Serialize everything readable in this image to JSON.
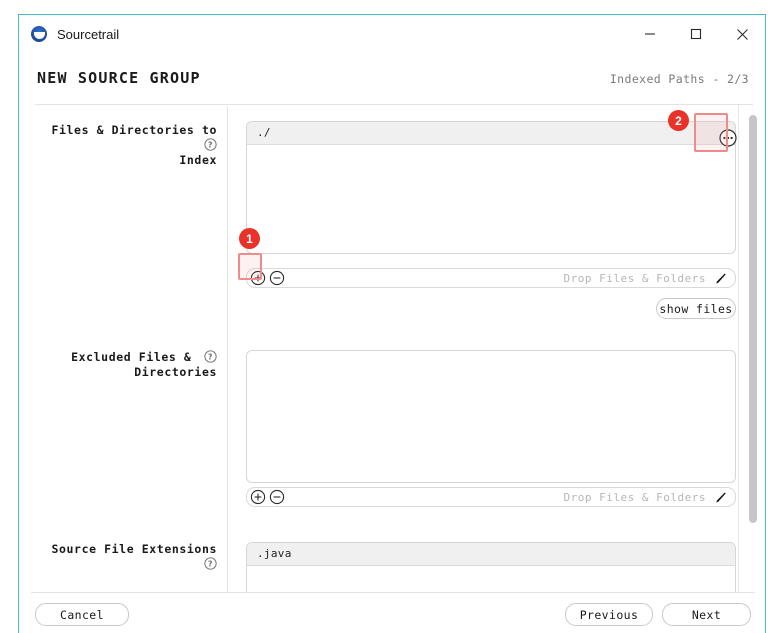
{
  "window": {
    "title": "Sourcetrail",
    "app_icon": "sourcetrail-logo-icon",
    "controls": {
      "minimize": "minimize-icon",
      "maximize": "maximize-icon",
      "close": "close-icon"
    },
    "accent_border": "#46bfc4"
  },
  "header": {
    "title": "NEW SOURCE GROUP",
    "step": "Indexed Paths - 2/3"
  },
  "form": {
    "rows": [
      {
        "label_line1": "Files & Directories to",
        "label_line2": "Index",
        "help_icon": "help-icon",
        "items": [
          "./"
        ],
        "bar": {
          "add_icon": "plus-circle-icon",
          "remove_icon": "minus-circle-icon",
          "drop_hint": "Drop Files & Folders",
          "edit_icon": "pencil-icon"
        },
        "more_icon": "ellipsis-circle-icon",
        "extra_button": "show files"
      },
      {
        "label_line1": "Excluded Files &",
        "label_line2": "Directories",
        "help_icon": "help-icon",
        "items": [],
        "bar": {
          "add_icon": "plus-circle-icon",
          "remove_icon": "minus-circle-icon",
          "drop_hint": "Drop Files & Folders",
          "edit_icon": "pencil-icon"
        }
      },
      {
        "label_line1": "Source File Extensions",
        "label_line2": "",
        "help_icon": "help-icon",
        "items": [
          ".java"
        ]
      }
    ]
  },
  "footer": {
    "cancel": "Cancel",
    "previous": "Previous",
    "next": "Next"
  },
  "annotations": {
    "badge_1": "1",
    "badge_2": "2",
    "highlight_color": "#f08b8b",
    "badge_color": "#e8322a"
  }
}
